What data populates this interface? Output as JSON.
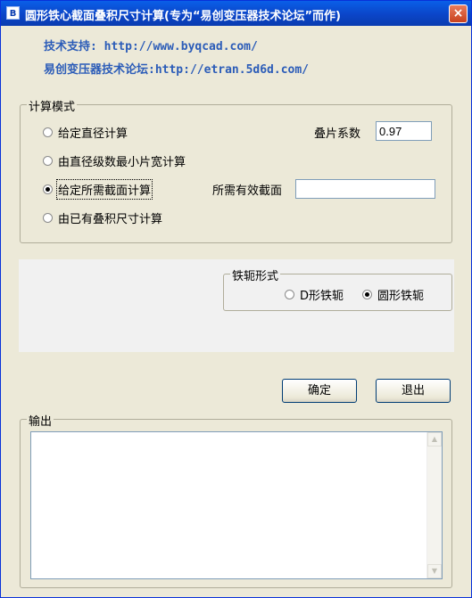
{
  "window": {
    "title": "圆形铁心截面叠积尺寸计算(专为“易创变压器技术论坛”而作)",
    "icon": "B",
    "close_label": "×"
  },
  "links": {
    "support": "技术支持: http://www.byqcad.com/",
    "forum": "易创变压器技术论坛:http://etran.5d6d.com/"
  },
  "calc_mode": {
    "title": "计算模式",
    "options": [
      {
        "label": "给定直径计算",
        "checked": false
      },
      {
        "label": "由直径级数最小片宽计算",
        "checked": false
      },
      {
        "label": "给定所需截面计算",
        "checked": true
      },
      {
        "label": "由已有叠积尺寸计算",
        "checked": false
      }
    ],
    "stack_factor_label": "叠片系数",
    "stack_factor_value": "0.97",
    "area_label": "所需有效截面",
    "area_value": ""
  },
  "yoke_shape": {
    "title": "铁轭形式",
    "options": [
      {
        "label": "D形铁轭",
        "checked": false
      },
      {
        "label": "圆形铁轭",
        "checked": true
      }
    ]
  },
  "buttons": {
    "ok": "确定",
    "exit": "退出"
  },
  "output": {
    "title": "输出",
    "text": ""
  },
  "colors": {
    "titlebar": "#0a5fe8",
    "link": "#2b5cb8",
    "window_bg": "#ece9d8"
  }
}
